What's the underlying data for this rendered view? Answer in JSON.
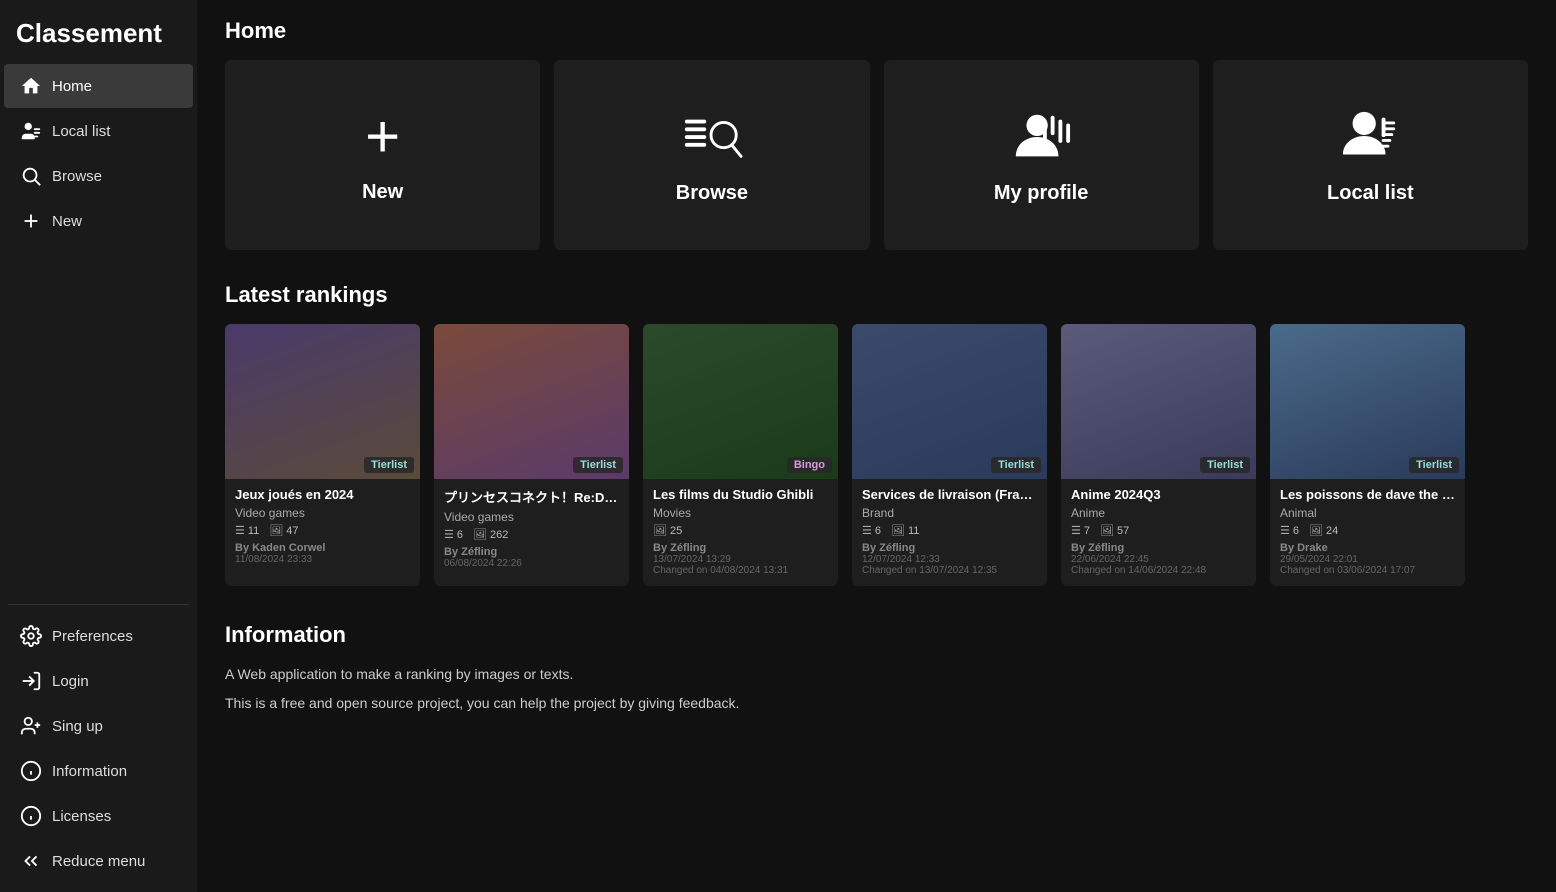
{
  "app": {
    "title": "Classement"
  },
  "sidebar": {
    "nav_items": [
      {
        "id": "home",
        "label": "Home",
        "icon": "home",
        "active": true
      },
      {
        "id": "locallist",
        "label": "Local list",
        "icon": "locallist",
        "active": false
      },
      {
        "id": "browse",
        "label": "Browse",
        "icon": "browse",
        "active": false
      },
      {
        "id": "new",
        "label": "New",
        "icon": "new",
        "active": false
      }
    ],
    "bottom_items": [
      {
        "id": "preferences",
        "label": "Preferences",
        "icon": "prefs"
      },
      {
        "id": "login",
        "label": "Login",
        "icon": "login"
      },
      {
        "id": "singup",
        "label": "Sing up",
        "icon": "singup"
      },
      {
        "id": "information",
        "label": "Information",
        "icon": "info"
      },
      {
        "id": "licenses",
        "label": "Licenses",
        "icon": "licenses"
      },
      {
        "id": "reduce",
        "label": "Reduce menu",
        "icon": "reduce"
      }
    ]
  },
  "main": {
    "home_title": "Home",
    "home_cards": [
      {
        "id": "new",
        "label": "New",
        "icon": "plus"
      },
      {
        "id": "browse",
        "label": "Browse",
        "icon": "browse"
      },
      {
        "id": "myprofile",
        "label": "My profile",
        "icon": "profile"
      },
      {
        "id": "locallist",
        "label": "Local list",
        "icon": "locallist"
      }
    ],
    "latest_title": "Latest rankings",
    "rankings": [
      {
        "id": 1,
        "title": "Jeux joués en 2024",
        "badge": "Tierlist",
        "category": "Video games",
        "items": 11,
        "images": 47,
        "author": "Kaden Corwel",
        "date": "11/08/2024 23:33",
        "changed": null,
        "thumb_class": "thumb-1"
      },
      {
        "id": 2,
        "title": "プリンセスコネクト！Re:Dive",
        "badge": "Tierlist",
        "category": "Video games",
        "items": 6,
        "images": 262,
        "author": "Zéfling",
        "date": "06/08/2024 22:26",
        "changed": null,
        "thumb_class": "thumb-2"
      },
      {
        "id": 3,
        "title": "Les films du Studio Ghibli",
        "badge": "Bingo",
        "category": "Movies",
        "items": null,
        "images": 25,
        "author": "Zéfling",
        "date": "13/07/2024 13:29",
        "changed": "04/08/2024 13:31",
        "thumb_class": "thumb-3"
      },
      {
        "id": 4,
        "title": "Services de livraison (France)",
        "badge": "Tierlist",
        "category": "Brand",
        "items": 6,
        "images": 11,
        "author": "Zéfling",
        "date": "12/07/2024 12:33",
        "changed": "13/07/2024 12:35",
        "thumb_class": "thumb-4"
      },
      {
        "id": 5,
        "title": "Anime 2024Q3",
        "badge": "Tierlist",
        "category": "Anime",
        "items": 7,
        "images": 57,
        "author": "Zéfling",
        "date": "22/06/2024 22:45",
        "changed": "14/06/2024 22:48",
        "thumb_class": "thumb-5"
      },
      {
        "id": 6,
        "title": "Les poissons de dave the diver",
        "badge": "Tierlist",
        "category": "Animal",
        "items": 6,
        "images": 24,
        "author": "Drake",
        "date": "29/05/2024 22:01",
        "changed": "03/06/2024 17:07",
        "thumb_class": "thumb-6"
      }
    ],
    "info_title": "Information",
    "info_texts": [
      "A Web application to make a ranking by images or texts.",
      "This is a free and open source project, you can help the project by giving feedback."
    ]
  }
}
